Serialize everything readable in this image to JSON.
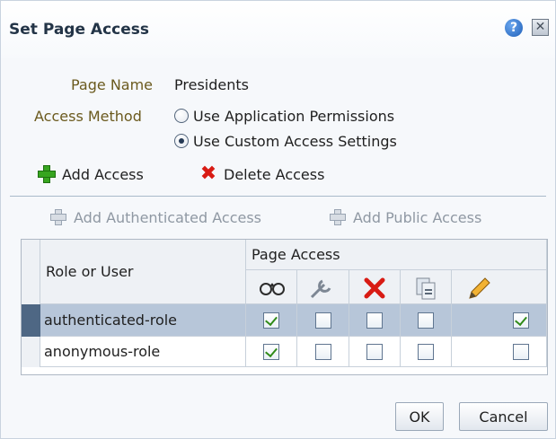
{
  "dialog": {
    "title": "Set Page Access",
    "help_icon": "help-icon",
    "close_icon": "close-icon"
  },
  "form": {
    "page_name_label": "Page Name",
    "page_name_value": "Presidents",
    "access_method_label": "Access Method",
    "options": [
      "Use Application Permissions",
      "Use Custom Access Settings"
    ],
    "selected_option": "Use Custom Access Settings"
  },
  "toolbar": {
    "add_access": "Add Access",
    "delete_access": "Delete Access",
    "add_authenticated": "Add Authenticated Access",
    "add_public": "Add Public Access"
  },
  "table": {
    "role_header": "Role or User",
    "page_access_header": "Page Access",
    "permission_icons": [
      "view-icon",
      "customize-icon",
      "delete-icon",
      "grant-icon",
      "edit-icon"
    ],
    "rows": [
      {
        "role": "authenticated-role",
        "checks": [
          true,
          false,
          false,
          false,
          true
        ]
      },
      {
        "role": "anonymous-role",
        "checks": [
          true,
          false,
          false,
          false,
          false
        ]
      }
    ]
  },
  "buttons": {
    "ok": "OK",
    "cancel": "Cancel"
  },
  "colors": {
    "title": "#233447",
    "label": "#6b5a1e",
    "selected_row": "#b7c6d9",
    "green": "#37a51f",
    "red": "#d81b14"
  }
}
